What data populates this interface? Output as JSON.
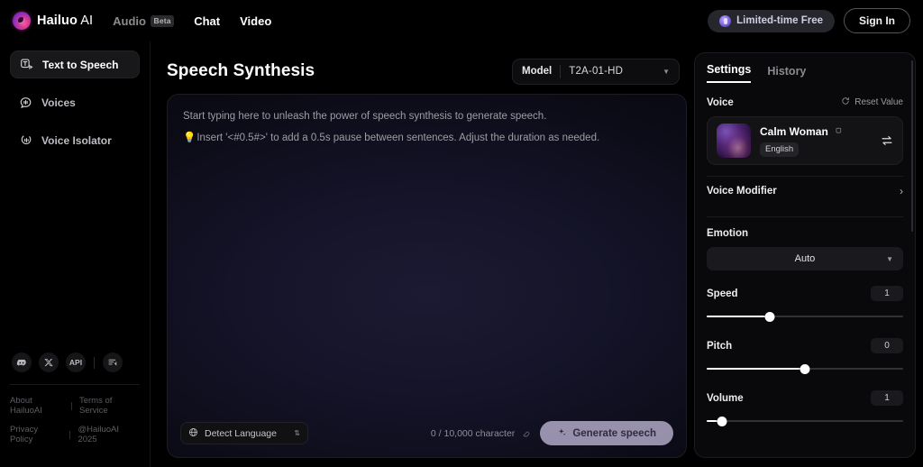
{
  "topbar": {
    "brand_name": "Hailuo",
    "brand_suffix": " AI",
    "nav": [
      {
        "label": "Audio",
        "badge": "Beta",
        "active": false
      },
      {
        "label": "Chat",
        "badge": "",
        "active": true
      },
      {
        "label": "Video",
        "badge": "",
        "active": true
      }
    ],
    "limited_free_label": "Limited-time Free",
    "sign_in_label": "Sign In"
  },
  "sidebar": {
    "items": [
      {
        "label": "Text to Speech",
        "icon": "text-to-speech-icon",
        "active": true
      },
      {
        "label": "Voices",
        "icon": "voices-icon",
        "active": false
      },
      {
        "label": "Voice Isolator",
        "icon": "voice-isolator-icon",
        "active": false
      }
    ],
    "socials": [
      {
        "name": "discord-icon",
        "label": ""
      },
      {
        "name": "x-twitter-icon",
        "label": ""
      },
      {
        "name": "api-icon",
        "label": "API"
      },
      {
        "name": "feedback-icon",
        "label": ""
      }
    ],
    "legal": {
      "about": "About HailuoAI",
      "terms": "Terms of Service",
      "privacy": "Privacy Policy",
      "copyright": "@HailuoAI 2025"
    }
  },
  "main": {
    "page_title": "Speech Synthesis",
    "model": {
      "label": "Model",
      "value": "T2A-01-HD"
    },
    "editor": {
      "placeholder_line1": "Start typing here to unleash the power of speech synthesis to generate speech.",
      "placeholder_line2_prefix": "💡",
      "placeholder_line2": "Insert '<#0.5#>' to add a 0.5s pause between sentences. Adjust the duration as needed.",
      "language_select": "Detect Language",
      "char_count": "0 / 10,000 character",
      "generate_label": "Generate speech"
    }
  },
  "settings": {
    "tabs": [
      {
        "label": "Settings",
        "active": true
      },
      {
        "label": "History",
        "active": false
      }
    ],
    "voice_section_label": "Voice",
    "reset_label": "Reset Value",
    "voice": {
      "name": "Calm Woman",
      "language": "English"
    },
    "voice_modifier_label": "Voice Modifier",
    "emotion_label": "Emotion",
    "emotion_value": "Auto",
    "sliders": [
      {
        "name": "Speed",
        "value": "1",
        "percent": 32
      },
      {
        "name": "Pitch",
        "value": "0",
        "percent": 50
      },
      {
        "name": "Volume",
        "value": "1",
        "percent": 8
      }
    ]
  },
  "colors": {
    "accent_purple": "#cdc4e4",
    "brand_pink": "#d93b8f",
    "panel_bg": "#09090b"
  }
}
